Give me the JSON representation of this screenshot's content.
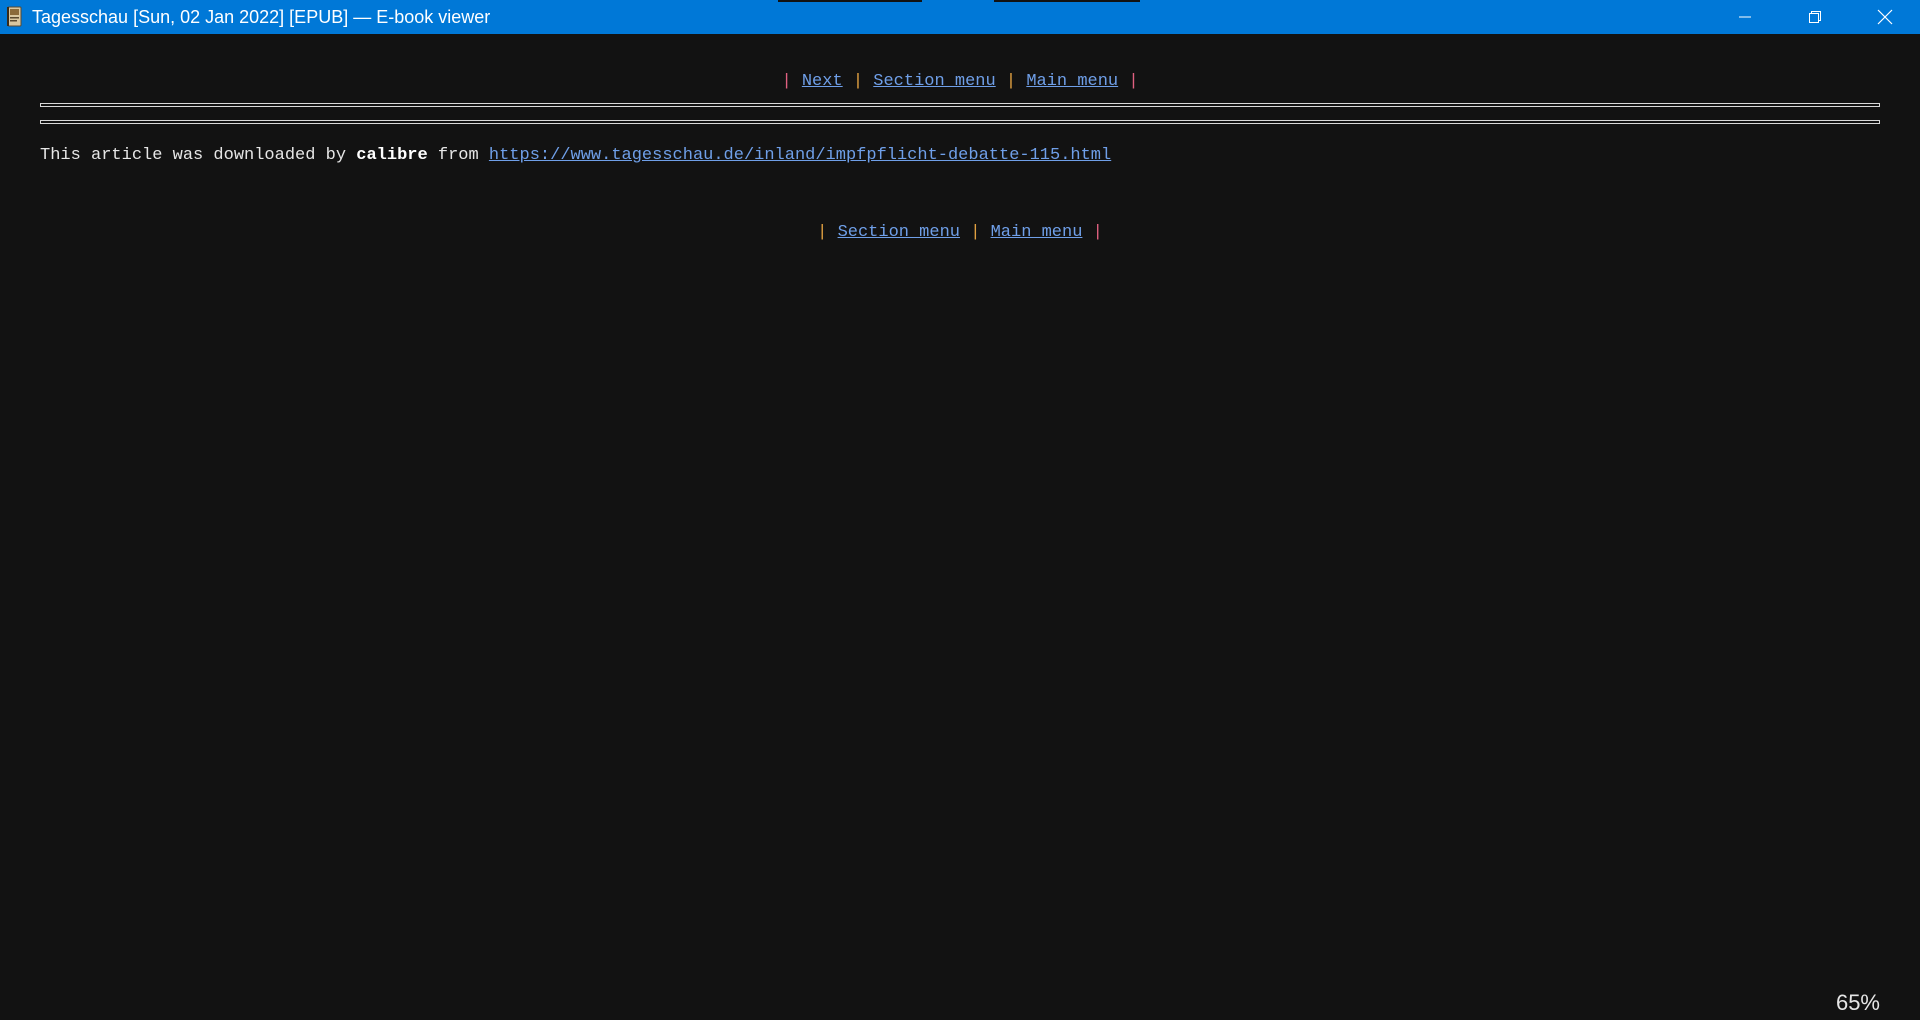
{
  "window": {
    "title": "Tagesschau [Sun, 02 Jan 2022] [EPUB] — E-book viewer",
    "icon": "book-icon",
    "caption_icons": [
      "minimize-icon",
      "restore-icon",
      "close-icon"
    ]
  },
  "colors": {
    "titlebar": "#0078d7",
    "background": "#121212",
    "link": "#6f9fe8",
    "separator_yellow": "#e0a040",
    "separator_pink": "#e06080"
  },
  "nav_top": {
    "sep": "|",
    "next": "Next",
    "section_menu": "Section menu",
    "main_menu": "Main menu"
  },
  "article": {
    "prefix": "This article was downloaded by",
    "brand": "calibre",
    "from": "from",
    "url": "https://www.tagesschau.de/inland/impfpflicht-debatte-115.html"
  },
  "nav_bottom": {
    "sep": "|",
    "section_menu": "Section menu",
    "main_menu": "Main menu"
  },
  "status": {
    "zoom": "65%"
  }
}
